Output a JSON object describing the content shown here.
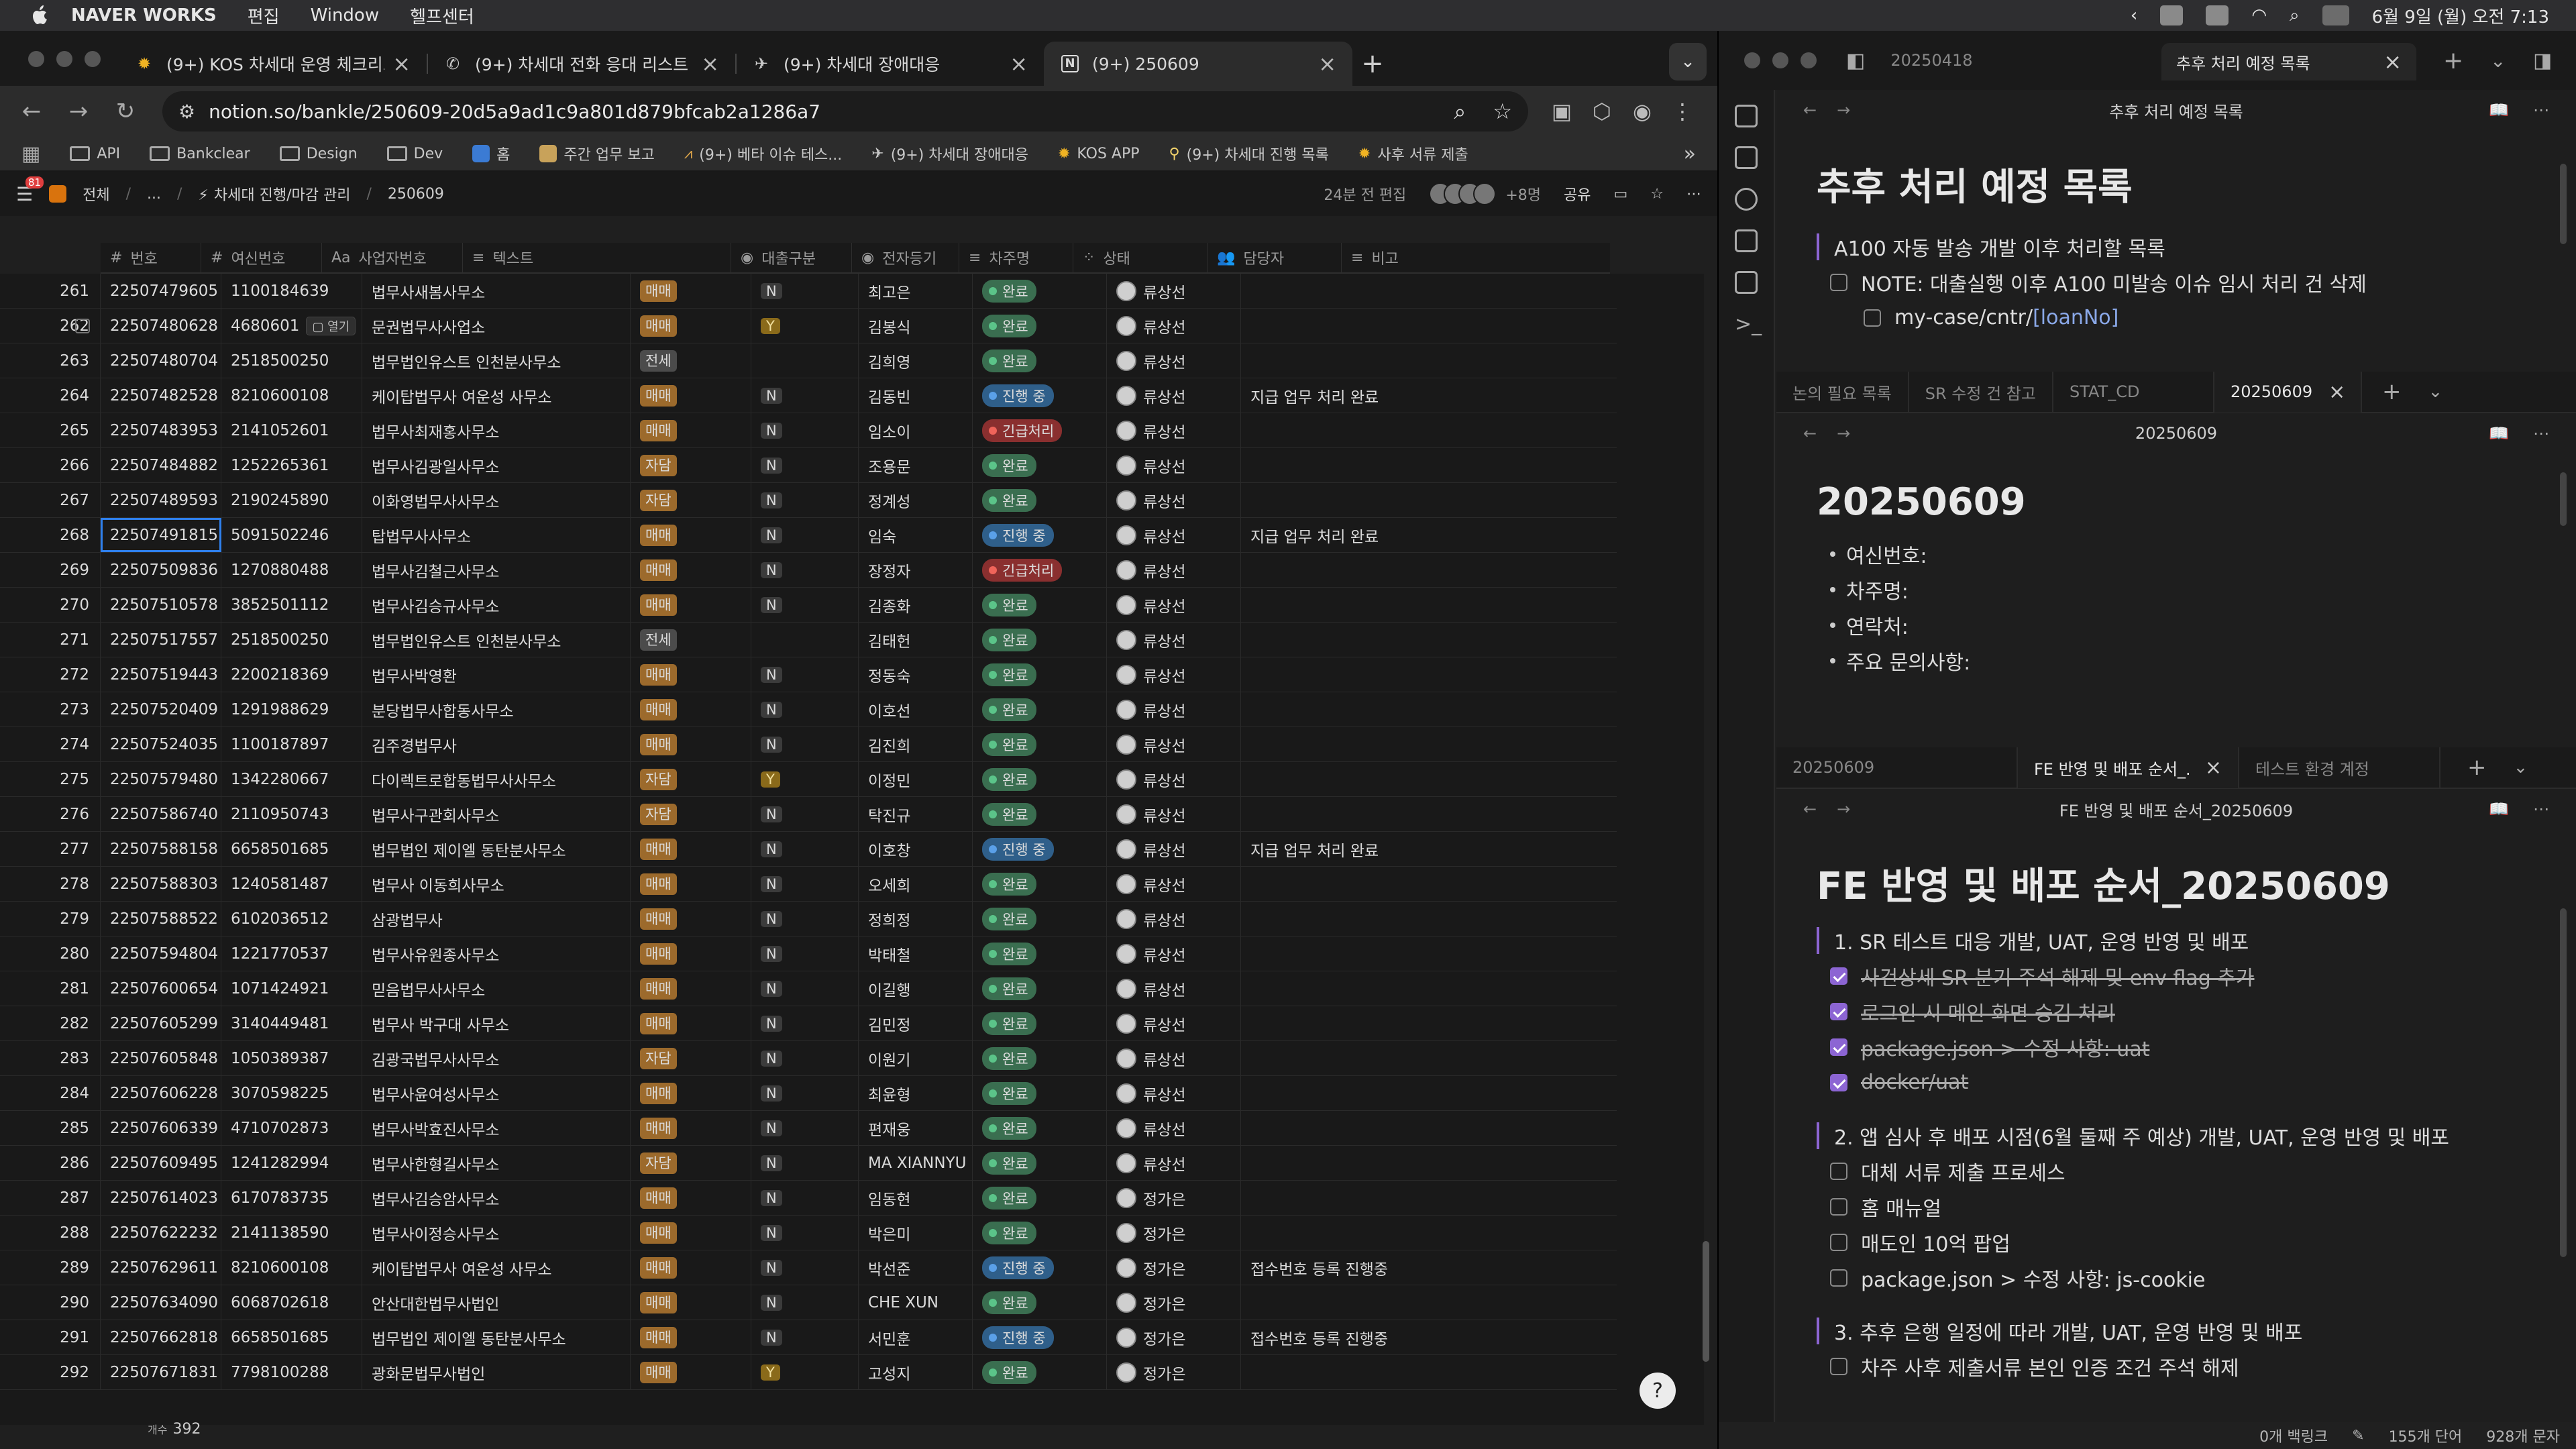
{
  "menubar": {
    "app": "NAVER WORKS",
    "menus": [
      "편집",
      "Window",
      "헬프센터"
    ],
    "datetime": "6월 9일 (월) 오전 7:13"
  },
  "browser": {
    "tabs": [
      {
        "label": "(9+) KOS 차세대 운영 체크리스트",
        "icon": "sun-icon"
      },
      {
        "label": "(9+) 차세대 전화 응대 리스트",
        "icon": "phone-icon"
      },
      {
        "label": "(9+) 차세대 장애대응",
        "icon": "plane-icon"
      },
      {
        "label": "(9+) 250609",
        "icon": "notion-icon"
      }
    ],
    "url": "notion.so/bankle/250609-20d5a9ad1c9a801d879bfcab2a1286a7",
    "bookmarks": [
      "API",
      "Bankclear",
      "Design",
      "Dev",
      "홈",
      "주간 업무 보고",
      "(9+) 베타 이슈 테스...",
      "(9+) 차세대 장애대응",
      "KOS APP",
      "(9+) 차세대 진행 목록",
      "사후 서류 제출"
    ]
  },
  "notion_topbar": {
    "badge": "81",
    "workspace": "전체",
    "ellipsis": "...",
    "crumb_parent": "차세대 진행/마감 관리",
    "crumb_page": "250609",
    "edited": "24분 전 편집",
    "members": "+8명",
    "share": "공유"
  },
  "table": {
    "headers": [
      "번호",
      "여신번호",
      "사업자번호",
      "텍스트",
      "대출구분",
      "전자등기",
      "차주명",
      "상태",
      "담당자",
      "비고"
    ],
    "status_colors": {
      "완료": "#3a6e50",
      "진행 중": "#2f5f8a",
      "긴급처리": "#8a2f2f"
    },
    "status_dots": {
      "완료": "#5bc489",
      "진행 중": "#5aa0e8",
      "긴급처리": "#f0645a"
    },
    "tag_colors": {
      "매매": "#9c6a2c",
      "자담": "#9c6a2c",
      "전세": "#4b4b4b"
    },
    "open_label": "열기",
    "rows": [
      {
        "no": "261",
        "loan": "22507479605",
        "biz": "1100184639",
        "text": "법무사새봄사무소",
        "type": "매매",
        "reg": "N",
        "owner": "최고은",
        "status": "완료",
        "mgr": "류상선",
        "note": ""
      },
      {
        "no": "262",
        "loan": "22507480628",
        "biz": "4680601",
        "text": "문권법무사사업소",
        "type": "매매",
        "reg": "Y",
        "owner": "김봉식",
        "status": "완료",
        "mgr": "류상선",
        "note": ""
      },
      {
        "no": "263",
        "loan": "22507480704",
        "biz": "2518500250",
        "text": "법무법인유스트 인천분사무소",
        "type": "전세",
        "reg": "",
        "owner": "김희영",
        "status": "완료",
        "mgr": "류상선",
        "note": ""
      },
      {
        "no": "264",
        "loan": "22507482528",
        "biz": "8210600108",
        "text": "케이탑법무사 여운성 사무소",
        "type": "매매",
        "reg": "N",
        "owner": "김동빈",
        "status": "진행 중",
        "mgr": "류상선",
        "note": "지급 업무 처리 완료"
      },
      {
        "no": "265",
        "loan": "22507483953",
        "biz": "2141052601",
        "text": "법무사최재홍사무소",
        "type": "매매",
        "reg": "N",
        "owner": "임소이",
        "status": "긴급처리",
        "mgr": "류상선",
        "note": ""
      },
      {
        "no": "266",
        "loan": "22507484882",
        "biz": "1252265361",
        "text": "법무사김광일사무소",
        "type": "자담",
        "reg": "N",
        "owner": "조용문",
        "status": "완료",
        "mgr": "류상선",
        "note": ""
      },
      {
        "no": "267",
        "loan": "22507489593",
        "biz": "2190245890",
        "text": "이화영법무사사무소",
        "type": "자담",
        "reg": "N",
        "owner": "정계성",
        "status": "완료",
        "mgr": "류상선",
        "note": ""
      },
      {
        "no": "268",
        "loan": "22507491815",
        "biz": "5091502246",
        "text": "탑법무사사무소",
        "type": "매매",
        "reg": "N",
        "owner": "임숙",
        "status": "진행 중",
        "mgr": "류상선",
        "note": "지급 업무 처리 완료"
      },
      {
        "no": "269",
        "loan": "22507509836",
        "biz": "1270880488",
        "text": "법무사김철근사무소",
        "type": "매매",
        "reg": "N",
        "owner": "장정자",
        "status": "긴급처리",
        "mgr": "류상선",
        "note": ""
      },
      {
        "no": "270",
        "loan": "22507510578",
        "biz": "3852501112",
        "text": "법무사김승규사무소",
        "type": "매매",
        "reg": "N",
        "owner": "김종화",
        "status": "완료",
        "mgr": "류상선",
        "note": ""
      },
      {
        "no": "271",
        "loan": "22507517557",
        "biz": "2518500250",
        "text": "법무법인유스트 인천분사무소",
        "type": "전세",
        "reg": "",
        "owner": "김태헌",
        "status": "완료",
        "mgr": "류상선",
        "note": ""
      },
      {
        "no": "272",
        "loan": "22507519443",
        "biz": "2200218369",
        "text": "법무사박영환",
        "type": "매매",
        "reg": "N",
        "owner": "정동숙",
        "status": "완료",
        "mgr": "류상선",
        "note": ""
      },
      {
        "no": "273",
        "loan": "22507520409",
        "biz": "1291988629",
        "text": "분당법무사합동사무소",
        "type": "매매",
        "reg": "N",
        "owner": "이호선",
        "status": "완료",
        "mgr": "류상선",
        "note": ""
      },
      {
        "no": "274",
        "loan": "22507524035",
        "biz": "1100187897",
        "text": "김주경법무사",
        "type": "매매",
        "reg": "N",
        "owner": "김진희",
        "status": "완료",
        "mgr": "류상선",
        "note": ""
      },
      {
        "no": "275",
        "loan": "22507579480",
        "biz": "1342280667",
        "text": "다이렉트로합동법무사사무소",
        "type": "자담",
        "reg": "Y",
        "owner": "이정민",
        "status": "완료",
        "mgr": "류상선",
        "note": ""
      },
      {
        "no": "276",
        "loan": "22507586740",
        "biz": "2110950743",
        "text": "법무사구관회사무소",
        "type": "자담",
        "reg": "N",
        "owner": "탁진규",
        "status": "완료",
        "mgr": "류상선",
        "note": ""
      },
      {
        "no": "277",
        "loan": "22507588158",
        "biz": "6658501685",
        "text": "법무법인 제이엘 동탄분사무소",
        "type": "매매",
        "reg": "N",
        "owner": "이호창",
        "status": "진행 중",
        "mgr": "류상선",
        "note": "지급 업무 처리 완료"
      },
      {
        "no": "278",
        "loan": "22507588303",
        "biz": "1240581487",
        "text": "법무사 이동희사무소",
        "type": "매매",
        "reg": "N",
        "owner": "오세희",
        "status": "완료",
        "mgr": "류상선",
        "note": ""
      },
      {
        "no": "279",
        "loan": "22507588522",
        "biz": "6102036512",
        "text": "삼광법무사",
        "type": "매매",
        "reg": "N",
        "owner": "정희정",
        "status": "완료",
        "mgr": "류상선",
        "note": ""
      },
      {
        "no": "280",
        "loan": "22507594804",
        "biz": "1221770537",
        "text": "법무사유원종사무소",
        "type": "매매",
        "reg": "N",
        "owner": "박태철",
        "status": "완료",
        "mgr": "류상선",
        "note": ""
      },
      {
        "no": "281",
        "loan": "22507600654",
        "biz": "1071424921",
        "text": "믿음법무사사무소",
        "type": "매매",
        "reg": "N",
        "owner": "이길행",
        "status": "완료",
        "mgr": "류상선",
        "note": ""
      },
      {
        "no": "282",
        "loan": "22507605299",
        "biz": "3140449481",
        "text": "법무사 박구대 사무소",
        "type": "매매",
        "reg": "N",
        "owner": "김민정",
        "status": "완료",
        "mgr": "류상선",
        "note": ""
      },
      {
        "no": "283",
        "loan": "22507605848",
        "biz": "1050389387",
        "text": "김광국법무사사무소",
        "type": "자담",
        "reg": "N",
        "owner": "이원기",
        "status": "완료",
        "mgr": "류상선",
        "note": ""
      },
      {
        "no": "284",
        "loan": "22507606228",
        "biz": "3070598225",
        "text": "법무사윤여성사무소",
        "type": "매매",
        "reg": "N",
        "owner": "최윤형",
        "status": "완료",
        "mgr": "류상선",
        "note": ""
      },
      {
        "no": "285",
        "loan": "22507606339",
        "biz": "4710702873",
        "text": "법무사박효진사무소",
        "type": "매매",
        "reg": "N",
        "owner": "편재웅",
        "status": "완료",
        "mgr": "류상선",
        "note": ""
      },
      {
        "no": "286",
        "loan": "22507609495",
        "biz": "1241282994",
        "text": "법무사한형길사무소",
        "type": "자담",
        "reg": "N",
        "owner": "MA XIANNYU",
        "status": "완료",
        "mgr": "류상선",
        "note": ""
      },
      {
        "no": "287",
        "loan": "22507614023",
        "biz": "6170783735",
        "text": "법무사김승암사무소",
        "type": "매매",
        "reg": "N",
        "owner": "임동현",
        "status": "완료",
        "mgr": "정가은",
        "note": ""
      },
      {
        "no": "288",
        "loan": "22507622232",
        "biz": "2141138590",
        "text": "법무사이정승사무소",
        "type": "매매",
        "reg": "N",
        "owner": "박은미",
        "status": "완료",
        "mgr": "정가은",
        "note": ""
      },
      {
        "no": "289",
        "loan": "22507629611",
        "biz": "8210600108",
        "text": "케이탑법무사 여운성 사무소",
        "type": "매매",
        "reg": "N",
        "owner": "박선준",
        "status": "진행 중",
        "mgr": "정가은",
        "note": "접수번호 등록 진행중"
      },
      {
        "no": "290",
        "loan": "22507634090",
        "biz": "6068702618",
        "text": "안산대한법무사법인",
        "type": "매매",
        "reg": "N",
        "owner": "CHE XUN",
        "status": "완료",
        "mgr": "정가은",
        "note": ""
      },
      {
        "no": "291",
        "loan": "22507662818",
        "biz": "6658501685",
        "text": "법무법인 제이엘 동탄분사무소",
        "type": "매매",
        "reg": "N",
        "owner": "서민훈",
        "status": "진행 중",
        "mgr": "정가은",
        "note": "접수번호 등록 진행중"
      },
      {
        "no": "292",
        "loan": "22507671831",
        "biz": "7798100288",
        "text": "광화문법무사법인",
        "type": "매매",
        "reg": "Y",
        "owner": "고성지",
        "status": "완료",
        "mgr": "정가은",
        "note": ""
      }
    ],
    "count_label": "개수",
    "count_value": "392"
  },
  "obsidian": {
    "top_tabs": [
      {
        "label": "20250418"
      },
      {
        "label": "추후 처리 예정 목록"
      }
    ],
    "pane1": {
      "nav_title": "추후 처리 예정 목록",
      "title": "추후 처리 예정 목록",
      "callout": "A100 자동 발송 개발 이후 처리할 목록",
      "note": "NOTE: 대출실행 이후 A100 미발송 이슈 임시 처리 건 삭제",
      "path_a": "my-case/cntr/",
      "path_b": "[loanNo]"
    },
    "pane2": {
      "tabs": [
        "논의 필요 목록",
        "SR 수정 건 참고",
        "STAT_CD",
        "20250609"
      ],
      "nav_title": "20250609",
      "title": "20250609",
      "bullets": [
        "여신번호:",
        "차주명:",
        "연락처:",
        "주요 문의사항:"
      ]
    },
    "pane3": {
      "tabs": [
        "20250609",
        "FE 반영 및 배포 순서_...",
        "테스트 환경 계정"
      ],
      "nav_title": "FE 반영 및 배포 순서_20250609",
      "title": "FE 반영 및 배포 순서_20250609",
      "sec1": "1. SR 테스트 대응 개발, UAT, 운영 반영 및 배포",
      "sec1_items": [
        "사건상세 SR 분기 주석 해제 및 env flag 추가",
        "로그인 시 메인 화면 승김 처리",
        "package.json > 수정 사항: uat",
        "docker/uat"
      ],
      "sec2": "2. 앱 심사 후 배포 시점(6월 둘째 주 예상) 개발, UAT, 운영 반영 및 배포",
      "sec2_items": [
        "대체 서류 제출 프로세스",
        "홈 매뉴얼",
        "매도인 10억 팝업",
        "package.json > 수정 사항: js-cookie"
      ],
      "sec3": "3. 추후 은행 일정에 따라 개발, UAT, 운영 반영 및 배포",
      "sec3_items": [
        "차주 사후 제출서류 본인 인증 조건 주석 해제"
      ]
    },
    "status": {
      "backlinks": "0개 백링크",
      "words": "155개 단어",
      "chars": "928개 문자"
    }
  }
}
